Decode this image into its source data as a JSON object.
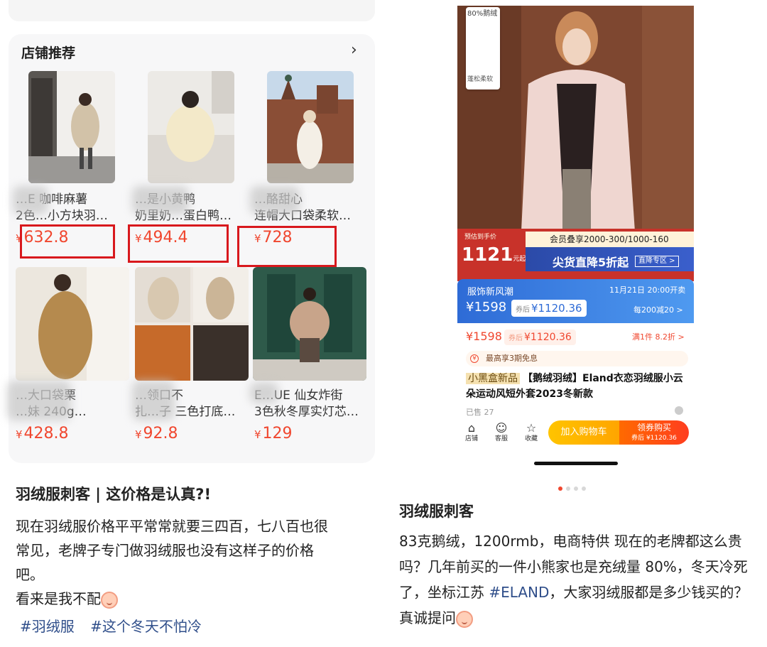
{
  "left": {
    "shop_section": {
      "title": "店铺推荐",
      "chevron": "›"
    },
    "products": [
      {
        "name_line1": "…E 咖啡麻薯",
        "name_line2": "2色…小方块羽…",
        "currency": "¥",
        "price": "632.8"
      },
      {
        "name_line1": "…是小黄鸭",
        "name_line2": "奶里奶…蛋白鸭…",
        "currency": "¥",
        "price": "494.4"
      },
      {
        "name_line1": "…酪甜心",
        "name_line2": "连帽大口袋柔软…",
        "currency": "¥",
        "price": "728"
      },
      {
        "name_line1": "…大口袋栗",
        "name_line2": "…妹 240g…",
        "currency": "¥",
        "price": "428.8"
      },
      {
        "name_line1": "…领口不",
        "name_line2": "扎…子 三色打底…",
        "currency": "¥",
        "price": "92.8"
      },
      {
        "name_line1": "E…UE 仙女炸街",
        "name_line2": "3色秋冬厚实灯芯…",
        "currency": "¥",
        "price": "129"
      }
    ],
    "post": {
      "title": "羽绒服刺客 | 这价格是认真?!",
      "body_lines": [
        "现在羽绒服价格平平常常就要三四百，七八百也很",
        "常见，老牌子专门做羽绒服也没有这样子的价格",
        "吧。",
        "看来是我不配"
      ],
      "tags": [
        "#羽绒服",
        "#这个冬天不怕冷"
      ]
    }
  },
  "right": {
    "hero": {
      "thumb_top_label": "80%鹅绒",
      "thumb_bottom_label": "蓬松柔软",
      "est_label": "预估到手价",
      "est_price": "1121",
      "est_unit": "元起",
      "member_text": "会员叠享2000-300/1000-160",
      "sale_text": "尖货直降5折起",
      "sale_button": "直降专区 >"
    },
    "promo_card": {
      "title": "服饰新风潮",
      "date": "11月21日 20:00开卖",
      "price": "¥1598",
      "after_label": "券后",
      "after_price": "¥1120.36",
      "rule": "每200减20 >"
    },
    "price_row": {
      "price": "¥1598",
      "after_label": "券后",
      "after_price": "¥1120.36",
      "deal": "满1件 8.2折 >"
    },
    "installment": "最高享3期免息",
    "product_title_tag": "小黑盒新品",
    "product_title": "【鹅绒羽绒】Eland衣恋羽绒服小云朵运动风短外套2023冬新款",
    "sold": "已售 27",
    "bottom_bar": {
      "shop": "店铺",
      "service": "客服",
      "favorite": "收藏",
      "cart": "加入购物车",
      "buy": "领券购买",
      "buy_sub": "券后 ¥1120.36"
    },
    "post": {
      "title": "羽绒服刺客",
      "body_part1": "83克鹅绒，1200rmb，电商特供 现在的老牌都这么贵吗？几年前买的一件小熊家也是充绒量 80%，冬天冷死了，坐标江苏 ",
      "tag": "#ELAND",
      "body_part2": "，大家羽绒服都是多少钱买的？真诚提问"
    }
  },
  "colors": {
    "price_red": "#f0472f",
    "highlight_box": "#d8181d",
    "tag_blue": "#2f4e8a",
    "promo_blue": "#2e6bd6"
  }
}
